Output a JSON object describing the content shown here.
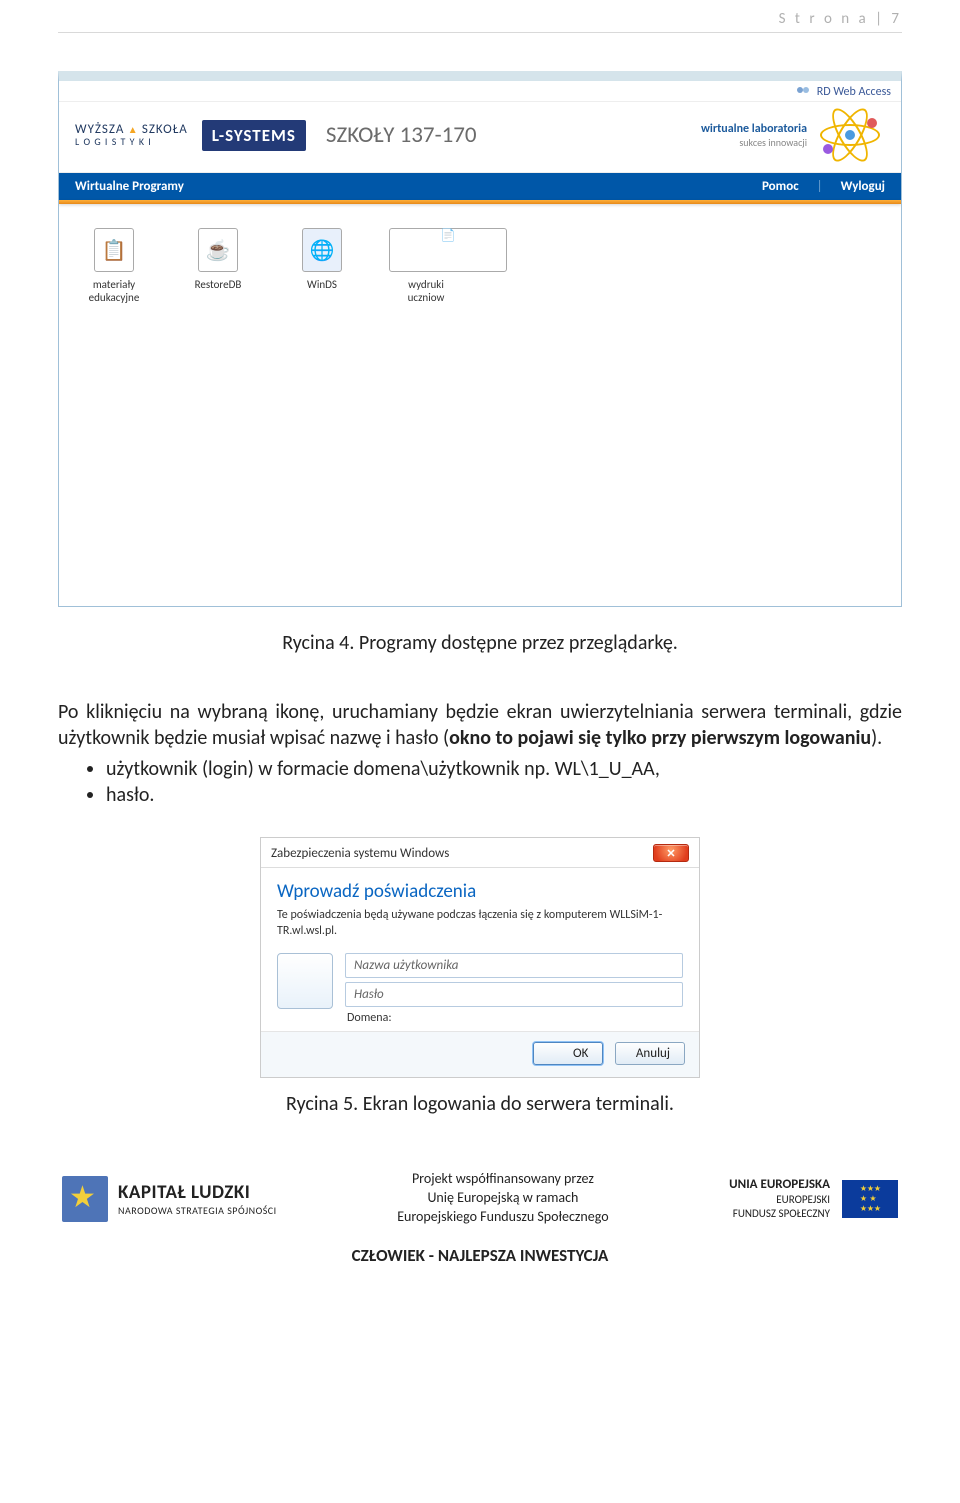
{
  "page_header": "S t r o n a  | 7",
  "screenshot1": {
    "rd_web": "RD Web Access",
    "wsl_top": "WYŻSZA",
    "wsl_szk": "SZKOŁA",
    "wsl_bottom": "L O G I S T Y K I",
    "lsystems": "L-SYSTEMS",
    "title": "SZKOŁY 137-170",
    "wirt1": "wirtualne laboratoria",
    "wirt2": "sukces innowacji",
    "bluebar_left": "Wirtualne Programy",
    "bluebar_help": "Pomoc",
    "bluebar_logout": "Wyloguj",
    "icons": [
      {
        "label": "materiały edukacyjne",
        "glyph": "📋"
      },
      {
        "label": "RestoreDB",
        "glyph": "☕"
      },
      {
        "label": "WinDS",
        "glyph": "🌐"
      },
      {
        "label": "wydruki uczniow",
        "glyph": "📄"
      }
    ]
  },
  "caption1": "Rycina 4. Programy dostępne przez przeglądarkę.",
  "para1_a": "Po kliknięciu na wybraną ikonę, uruchamiany będzie ekran uwierzytelniania serwera terminali, gdzie użytkownik będzie musiał wpisać nazwę i hasło (",
  "para1_b": "okno to pojawi się tylko przy pierwszym logowaniu",
  "para1_c": ").",
  "bullet1": "użytkownik (login) w formacie domena\\użytkownik np. WL\\1_U_AA,",
  "bullet2": "hasło.",
  "dialog": {
    "title": "Zabezpieczenia systemu Windows",
    "heading": "Wprowadź poświadczenia",
    "sub": "Te poświadczenia będą używane podczas łączenia się z komputerem WLLSiM-1-TR.wl.wsl.pl.",
    "user_ph": "Nazwa użytkownika",
    "pass_ph": "Hasło",
    "domain": "Domena:",
    "ok": "OK",
    "cancel": "Anuluj"
  },
  "caption2": "Rycina 5. Ekran logowania do serwera terminali.",
  "footer": {
    "kl1": "KAPITAŁ LUDZKI",
    "kl2": "NARODOWA STRATEGIA SPÓJNOŚCI",
    "proj1": "Projekt współfinansowany przez",
    "proj2": "Unię Europejską w ramach",
    "proj3": "Europejskiego Funduszu Społecznego",
    "eu1": "UNIA EUROPEJSKA",
    "eu2": "EUROPEJSKI",
    "eu3": "FUNDUSZ SPOŁECZNY",
    "invest": "CZŁOWIEK - NAJLEPSZA INWESTYCJA"
  }
}
